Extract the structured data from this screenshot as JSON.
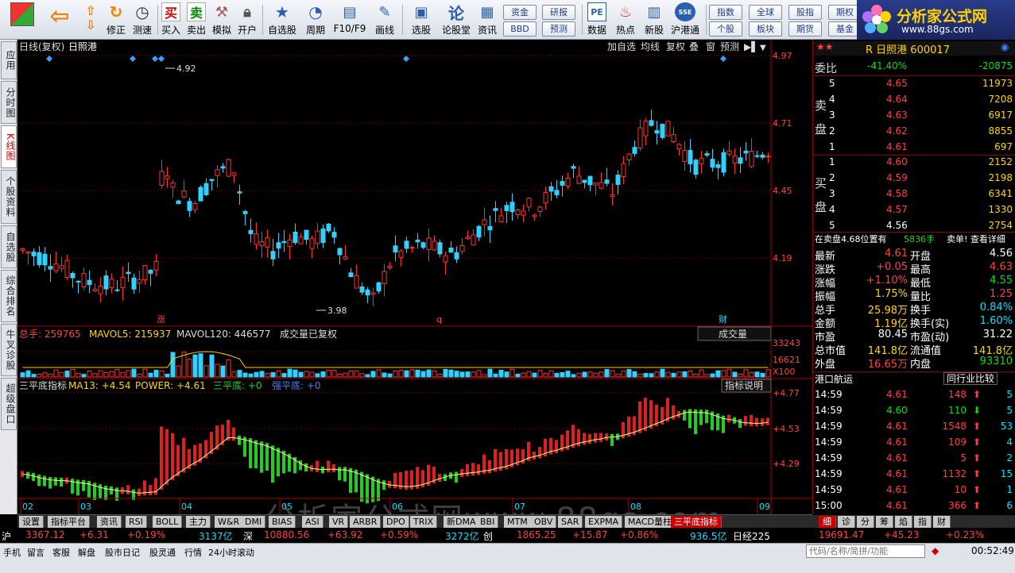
{
  "toolbar": {
    "buttons": [
      "修正",
      "测速",
      "买入",
      "卖出",
      "模拟",
      "开户",
      "自选股",
      "周期",
      "F10/F9",
      "画线",
      "选股",
      "论股堂",
      "资讯",
      "数据",
      "热点",
      "新股",
      "沪港通"
    ],
    "small_buttons": [
      "资金",
      "研报",
      "指数",
      "全球",
      "股指",
      "期权",
      "BBD",
      "预测",
      "个股",
      "板块",
      "期货",
      "基金"
    ]
  },
  "logo": {
    "title": "分析家公式网",
    "url_text": "www.88gs.com"
  },
  "left_tabs": [
    "应用",
    "分时图",
    "K线图",
    "个股资料",
    "自选股",
    "综合排名",
    "牛叉诊股",
    "超级盘口"
  ],
  "chart": {
    "header_left": "日线(复权)",
    "stock_name": "日照港",
    "header_buttons": [
      "加自选",
      "均线",
      "复权",
      "叠",
      "窗",
      "预测"
    ],
    "price_axis": [
      "4.97",
      "4.71",
      "4.45",
      "4.19"
    ],
    "high_label": "4.92",
    "low_label": "3.98",
    "markers": [
      "涨",
      "q",
      "财"
    ],
    "volume_line": {
      "total": "总手: 259765",
      "ma5": "MAVOL5: 215937",
      "ma120": "MAVOL120: 446577",
      "note": "成交量已复权",
      "selector": "成交量"
    },
    "volume_axis": [
      "33243",
      "16621",
      "X100"
    ],
    "indicator_line": {
      "name": "三平底指标",
      "ma13": "MA13: +4.54",
      "power": "POWER: +4.61",
      "spd": "三平底: +0",
      "qpd": "强平底: +0",
      "help": "指标说明"
    },
    "indicator_axis": [
      "+4.77",
      "+4.53",
      "+4.29"
    ],
    "months": [
      "02",
      "03",
      "04",
      "05",
      "06",
      "07",
      "08",
      "09"
    ],
    "watermark": "分析家公式网www.88gs.com"
  },
  "quote": {
    "title": "R 日照港 600017",
    "weibi_label": "委比",
    "weibi_pct": "-41.40%",
    "weibi_val": "-20875",
    "sell_label": "卖盘",
    "buy_label": "买盘",
    "sell": [
      {
        "lvl": "5",
        "price": "4.65",
        "vol": "11973"
      },
      {
        "lvl": "4",
        "price": "4.64",
        "vol": "7208"
      },
      {
        "lvl": "3",
        "price": "4.63",
        "vol": "6917"
      },
      {
        "lvl": "2",
        "price": "4.62",
        "vol": "8855"
      },
      {
        "lvl": "1",
        "price": "4.61",
        "vol": "697"
      }
    ],
    "buy": [
      {
        "lvl": "1",
        "price": "4.60",
        "vol": "2152"
      },
      {
        "lvl": "2",
        "price": "4.59",
        "vol": "2198"
      },
      {
        "lvl": "3",
        "price": "4.58",
        "vol": "6341"
      },
      {
        "lvl": "4",
        "price": "4.57",
        "vol": "1330"
      },
      {
        "lvl": "5",
        "price": "4.56",
        "vol": "2754"
      }
    ],
    "info_line": "在卖盘4.68位置有",
    "info_vol": "5836手",
    "info_action": "卖单! 查看详细",
    "stats": [
      {
        "k1": "最新",
        "v1": "4.61",
        "c1": "red",
        "k2": "开盘",
        "v2": "4.56",
        "c2": "wht"
      },
      {
        "k1": "涨跌",
        "v1": "+0.05",
        "c1": "red",
        "k2": "最高",
        "v2": "4.63",
        "c2": "red"
      },
      {
        "k1": "涨幅",
        "v1": "+1.10%",
        "c1": "red",
        "k2": "最低",
        "v2": "4.55",
        "c2": "grn"
      },
      {
        "k1": "振幅",
        "v1": "1.75%",
        "c1": "yel",
        "k2": "量比",
        "v2": "1.25",
        "c2": "red"
      },
      {
        "k1": "总手",
        "v1": "25.98万",
        "c1": "yel",
        "k2": "换手",
        "v2": "0.84%",
        "c2": "cyan"
      },
      {
        "k1": "金额",
        "v1": "1.19亿",
        "c1": "yel",
        "k2": "换手(实)",
        "v2": "1.60%",
        "c2": "cyan"
      },
      {
        "k1": "市盈",
        "v1": "80.45",
        "c1": "wht",
        "k2": "市盈(动)",
        "v2": "31.22",
        "c2": "wht"
      },
      {
        "k1": "总市值",
        "v1": "141.8亿",
        "c1": "yel",
        "k2": "流通值",
        "v2": "141.8亿",
        "c2": "yel"
      },
      {
        "k1": "外盘",
        "v1": "16.65万",
        "c1": "red",
        "k2": "内盘",
        "v2": "93310",
        "c2": "grn"
      }
    ],
    "industry": "港口航运",
    "industry_btn": "同行业比较",
    "ticks": [
      {
        "t": "14:59",
        "p": "4.61",
        "v": "148",
        "dir": "up",
        "n": "5"
      },
      {
        "t": "14:59",
        "p": "4.60",
        "v": "110",
        "dir": "down",
        "n": "5"
      },
      {
        "t": "14:59",
        "p": "4.61",
        "v": "1548",
        "dir": "up",
        "n": "53"
      },
      {
        "t": "14:59",
        "p": "4.61",
        "v": "109",
        "dir": "up",
        "n": "4"
      },
      {
        "t": "14:59",
        "p": "4.61",
        "v": "5",
        "dir": "up",
        "n": "2"
      },
      {
        "t": "14:59",
        "p": "4.61",
        "v": "1132",
        "dir": "up",
        "n": "15"
      },
      {
        "t": "14:59",
        "p": "4.61",
        "v": "10",
        "dir": "up",
        "n": "1"
      },
      {
        "t": "15:00",
        "p": "4.61",
        "v": "366",
        "dir": "up",
        "n": "6"
      }
    ],
    "tabs": [
      "细",
      "诊",
      "分",
      "筹",
      "焰",
      "指",
      "财"
    ]
  },
  "bottom_tabs": [
    "设置",
    "指标平台",
    "资讯",
    "RSI",
    "BOLL",
    "主力",
    "W&R",
    "DMI",
    "BIAS",
    "ASI",
    "VR",
    "ARBR",
    "DPO",
    "TRIX",
    "新DMA",
    "BBI",
    "MTM",
    "OBV",
    "SAR",
    "EXPMA",
    "MACD量柱",
    "三平底指标"
  ],
  "status": {
    "sh_label": "沪",
    "sh_idx": "3367.12",
    "sh_chg": "+6.31",
    "sh_pct": "+0.19%",
    "sh_amt": "3137亿",
    "sz_label": "深",
    "sz_idx": "10880.56",
    "sz_chg": "+63.92",
    "sz_pct": "+0.59%",
    "sz_amt": "3272亿",
    "cy_label": "创",
    "cy_idx": "1865.25",
    "cy_chg": "+15.87",
    "cy_pct": "+0.86%",
    "cy_amt": "936.5亿",
    "nk_label": "日经225",
    "nk_idx": "19691.47",
    "nk_chg": "+45.23",
    "nk_pct": "+0.23%"
  },
  "footer": {
    "items": [
      "手机",
      "留言",
      "客服",
      "解盘",
      "股市日记",
      "股灵通",
      "行情",
      "24小时滚动"
    ],
    "search_placeholder": "代码/名称/简拼/功能",
    "clock": "00:52:49"
  }
}
